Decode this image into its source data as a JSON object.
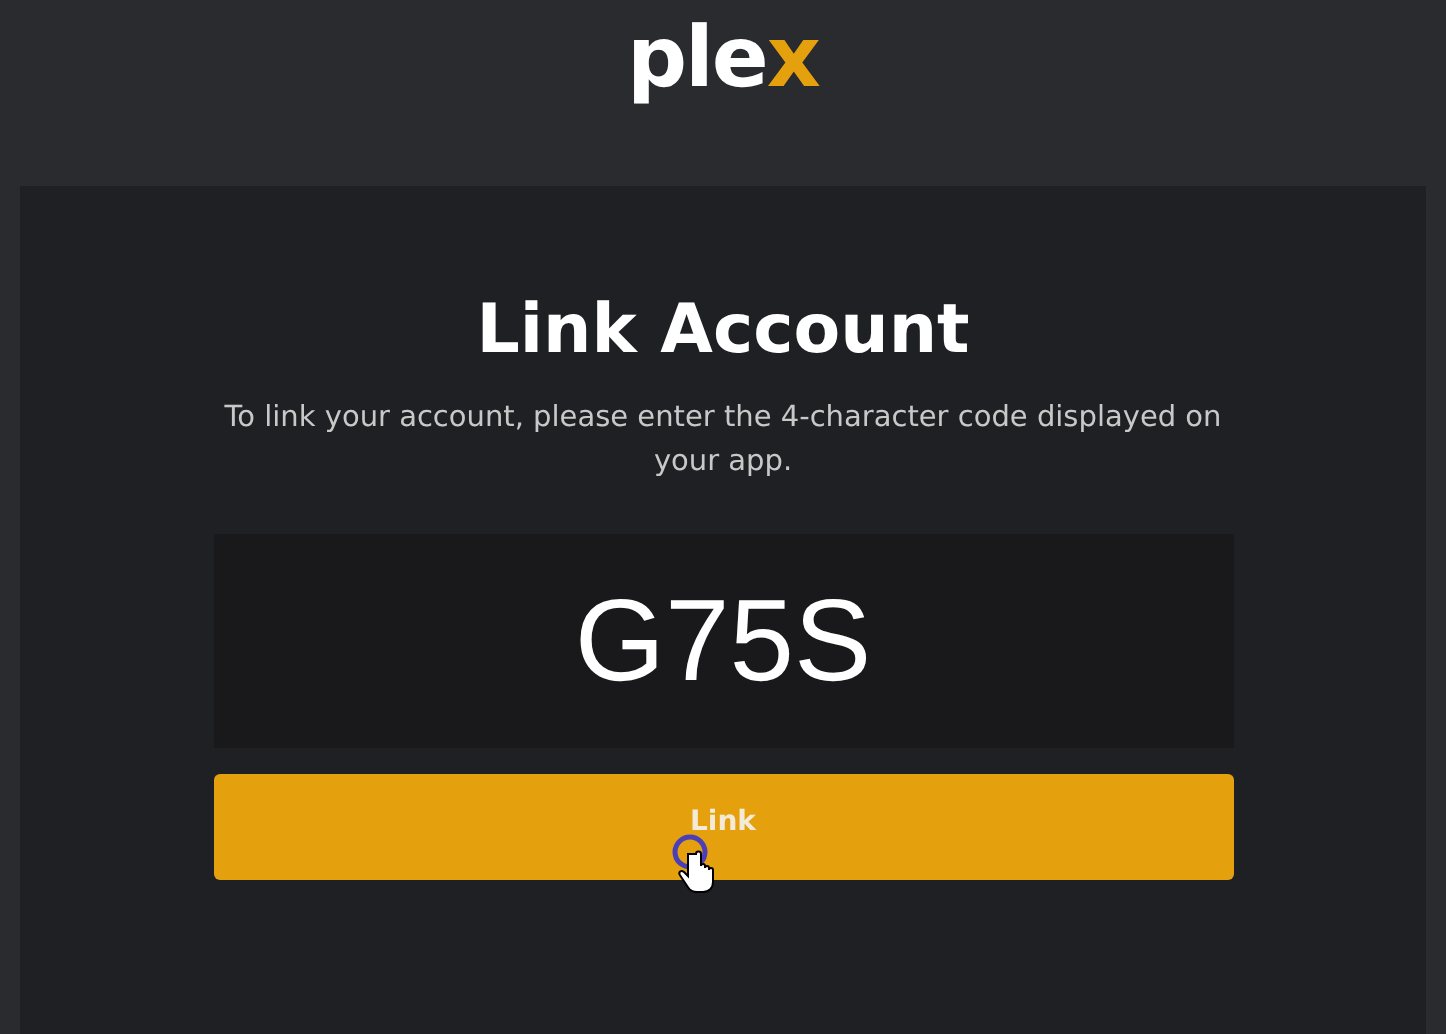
{
  "header": {
    "logo": "plex"
  },
  "card": {
    "title": "Link Account",
    "description": "To link your account, please enter the 4-character code displayed on your app.",
    "code_field": {
      "value": "G75S"
    },
    "button": "Link"
  }
}
